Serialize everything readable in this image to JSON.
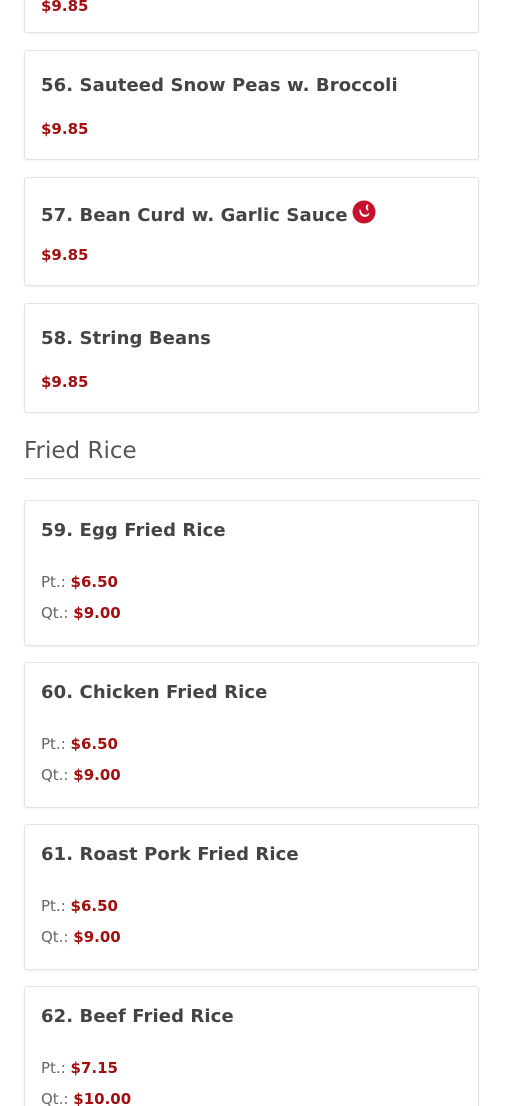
{
  "menu": {
    "top_partial_price": "$9.85",
    "items_vegetables": [
      {
        "name": "56. Sauteed Snow Peas w. Broccoli",
        "price": "$9.85"
      },
      {
        "name": "57. Bean Curd w. Garlic Sauce",
        "price": "$9.85",
        "icon": "spicy-chili-icon"
      },
      {
        "name": "58. String Beans",
        "price": "$9.85"
      }
    ],
    "section_fried_rice": {
      "title": "Fried Rice",
      "items": [
        {
          "name": "59. Egg Fried Rice",
          "pt_label": "Pt.:",
          "pt_price": "$6.50",
          "qt_label": "Qt.:",
          "qt_price": "$9.00"
        },
        {
          "name": "60. Chicken Fried Rice",
          "pt_label": "Pt.:",
          "pt_price": "$6.50",
          "qt_label": "Qt.:",
          "qt_price": "$9.00"
        },
        {
          "name": "61. Roast Pork Fried Rice",
          "pt_label": "Pt.:",
          "pt_price": "$6.50",
          "qt_label": "Qt.:",
          "qt_price": "$9.00"
        },
        {
          "name": "62. Beef Fried Rice",
          "pt_label": "Pt.:",
          "pt_price": "$7.15",
          "qt_label": "Qt.:",
          "qt_price": "$10.00"
        }
      ]
    }
  },
  "colors": {
    "price": "#a30f0f",
    "spicy_icon": "#c8102e"
  }
}
